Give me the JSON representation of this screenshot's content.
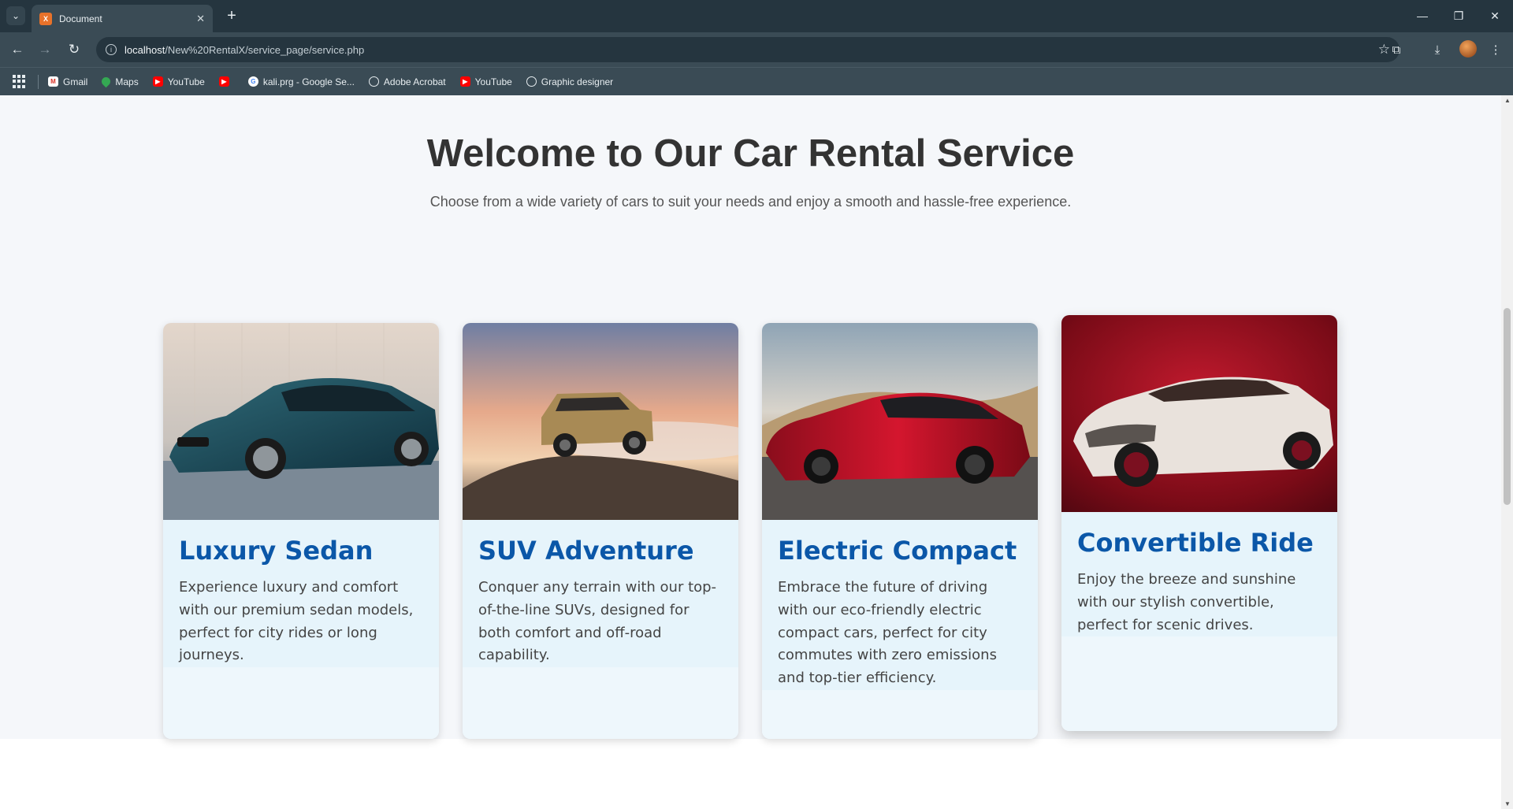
{
  "browser": {
    "tab_title": "Document",
    "url_host": "localhost",
    "url_path": "/New%20RentalX/service_page/service.php",
    "bookmarks": [
      {
        "label": "Gmail",
        "icon": "gmail-icon"
      },
      {
        "label": "Maps",
        "icon": "maps-icon"
      },
      {
        "label": "YouTube",
        "icon": "youtube-icon"
      },
      {
        "label": "",
        "icon": "youtube-icon"
      },
      {
        "label": "kali.prg - Google Se...",
        "icon": "google-icon"
      },
      {
        "label": "Adobe Acrobat",
        "icon": "globe-icon"
      },
      {
        "label": "YouTube",
        "icon": "youtube-icon"
      },
      {
        "label": "Graphic designer",
        "icon": "globe-icon"
      }
    ]
  },
  "page": {
    "title": "Welcome to Our Car Rental Service",
    "subtitle": "Choose from a wide variety of cars to suit your needs and enjoy a smooth and hassle-free experience.",
    "cards": [
      {
        "title": "Luxury Sedan",
        "description": "Experience luxury and comfort with our premium sedan models, perfect for city rides or long journeys."
      },
      {
        "title": "SUV Adventure",
        "description": "Conquer any terrain with our top-of-the-line SUVs, designed for both comfort and off-road capability."
      },
      {
        "title": "Electric Compact",
        "description": "Embrace the future of driving with our eco-friendly electric compact cars, perfect for city commutes with zero emissions and top-tier efficiency."
      },
      {
        "title": "Convertible Ride",
        "description": "Enjoy the breeze and sunshine with our stylish convertible, perfect for scenic drives."
      }
    ]
  },
  "colors": {
    "accent": "#0b57a8",
    "chrome_dark": "#25353f",
    "chrome": "#3a4b55"
  }
}
